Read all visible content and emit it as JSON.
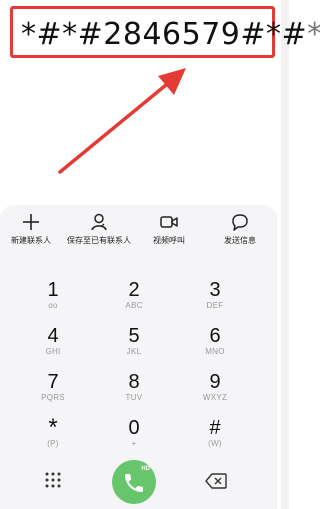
{
  "dialer": {
    "number_typed": "*#*#2846579#*#",
    "number_pending": "*"
  },
  "actions": [
    {
      "label": "新建联系人",
      "icon": "plus-icon"
    },
    {
      "label": "保存至已有联系人",
      "icon": "person-icon"
    },
    {
      "label": "视频呼叫",
      "icon": "video-icon"
    },
    {
      "label": "发送信息",
      "icon": "message-icon"
    }
  ],
  "keypad": [
    {
      "digit": "1",
      "sub": "oo"
    },
    {
      "digit": "2",
      "sub": "ABC"
    },
    {
      "digit": "3",
      "sub": "DEF"
    },
    {
      "digit": "4",
      "sub": "GHI"
    },
    {
      "digit": "5",
      "sub": "JKL"
    },
    {
      "digit": "6",
      "sub": "MNO"
    },
    {
      "digit": "7",
      "sub": "PQRS"
    },
    {
      "digit": "8",
      "sub": "TUV"
    },
    {
      "digit": "9",
      "sub": "WXYZ"
    },
    {
      "digit": "*",
      "sub": "(P)"
    },
    {
      "digit": "0",
      "sub": "+"
    },
    {
      "digit": "#",
      "sub": "(W)"
    }
  ],
  "call_button": {
    "badge": "HD",
    "icon": "phone-icon"
  },
  "colors": {
    "highlight": "#e43c35",
    "call": "#67c56c"
  }
}
